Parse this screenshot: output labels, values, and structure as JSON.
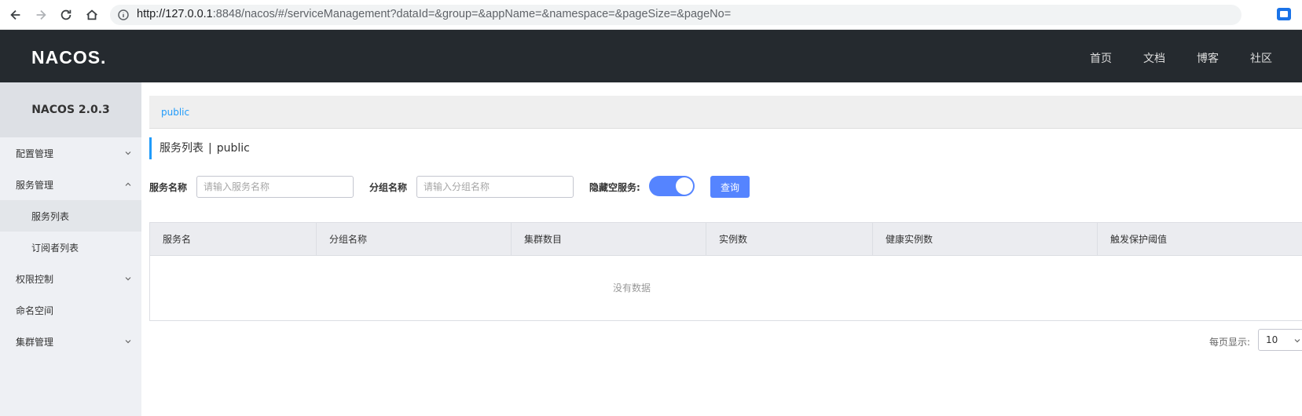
{
  "browser": {
    "url_host": "http://127.0.0.1",
    "url_rest": ":8848/nacos/#/serviceManagement?dataId=&group=&appName=&namespace=&pageSize=&pageNo="
  },
  "header": {
    "logo": "NACOS.",
    "nav": [
      "首页",
      "文档",
      "博客",
      "社区"
    ]
  },
  "sidebar": {
    "title": "NACOS 2.0.3",
    "items": [
      {
        "label": "配置管理",
        "icon": "chevron-down-icon"
      },
      {
        "label": "服务管理",
        "icon": "chevron-up-icon"
      },
      {
        "label": "服务列表"
      },
      {
        "label": "订阅者列表"
      },
      {
        "label": "权限控制",
        "icon": "chevron-down-icon"
      },
      {
        "label": "命名空间"
      },
      {
        "label": "集群管理",
        "icon": "chevron-down-icon"
      }
    ]
  },
  "main": {
    "namespace_link": "public",
    "title": "服务列表",
    "title_sep": "|",
    "title_ns": "public",
    "filters": {
      "service_label": "服务名称",
      "service_placeholder": "请输入服务名称",
      "group_label": "分组名称",
      "group_placeholder": "请输入分组名称",
      "hide_empty_label": "隐藏空服务:",
      "hide_empty_on": true,
      "query_label": "查询"
    },
    "table": {
      "columns": [
        "服务名",
        "分组名称",
        "集群数目",
        "实例数",
        "健康实例数",
        "触发保护阈值"
      ],
      "empty": "没有数据"
    },
    "pagination": {
      "page_size_label": "每页显示:",
      "page_size_value": "10"
    }
  },
  "colors": {
    "header_bg": "#252a2f",
    "accent": "#5584ff",
    "link": "#209bfa"
  }
}
